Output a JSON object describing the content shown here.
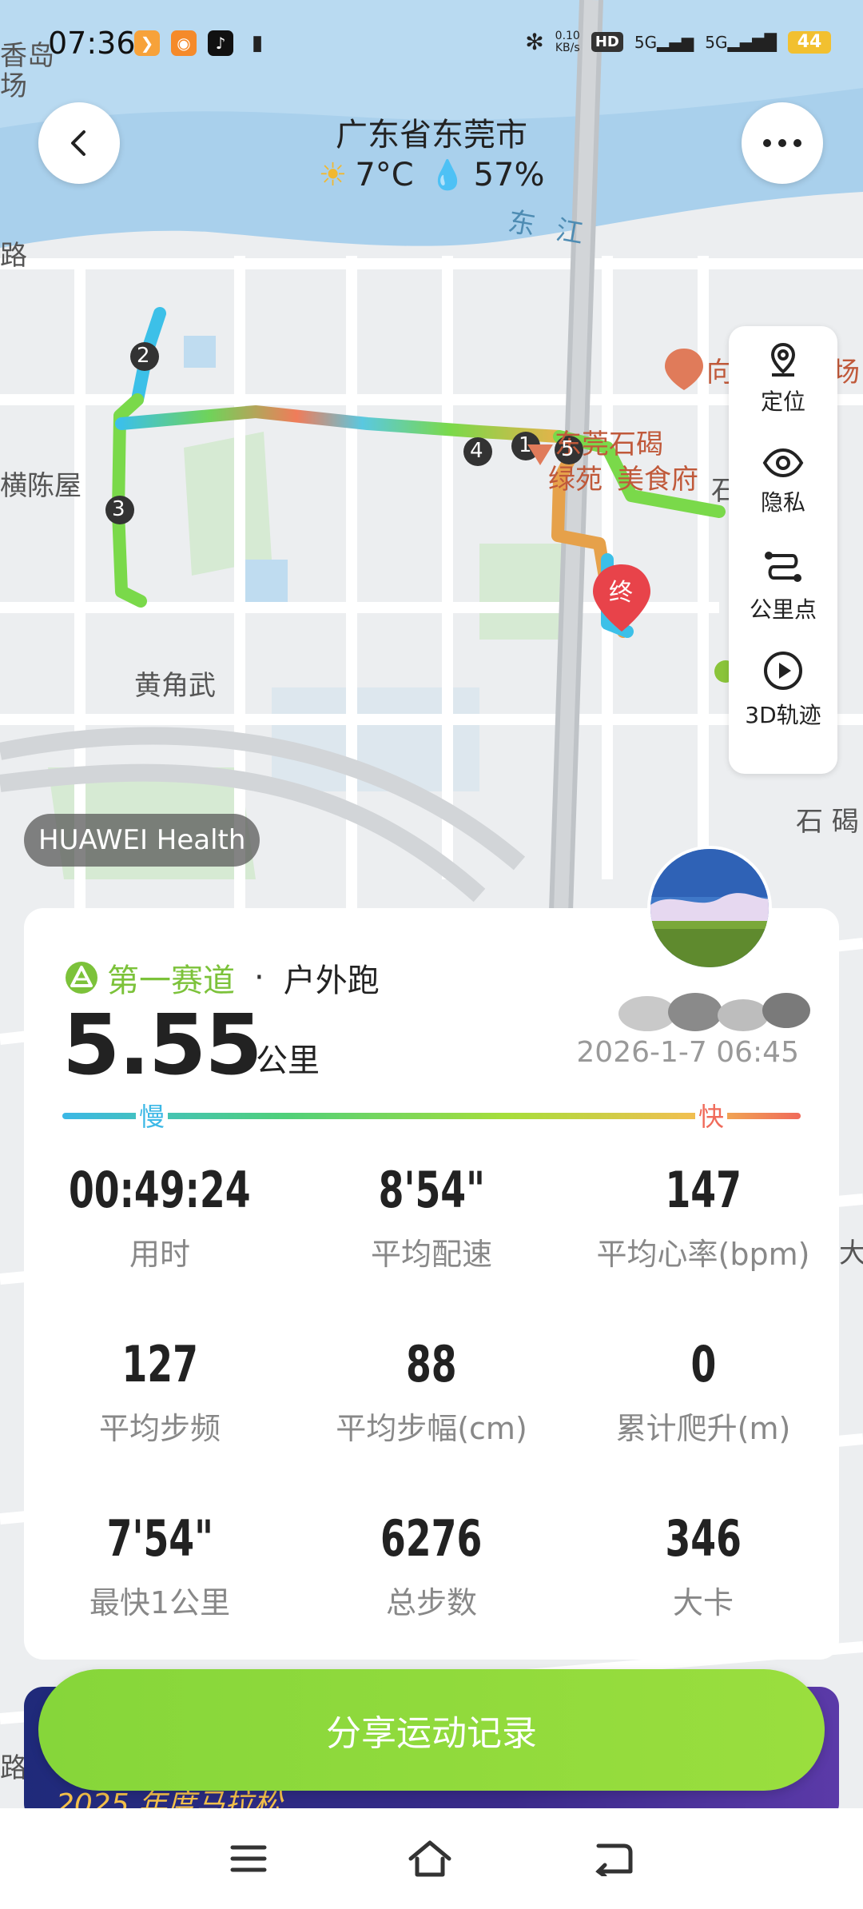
{
  "status_bar": {
    "time": "07:36",
    "net_speed_value": "0.10",
    "net_speed_unit": "KB/s",
    "hd_label": "HD",
    "signal_1": "5G",
    "signal_2": "5G",
    "battery": "44"
  },
  "header": {
    "location": "广东省东莞市",
    "temperature": "7°C",
    "humidity": "57%"
  },
  "map": {
    "labels": {
      "top_left": "香岛",
      "top_left_2": "场",
      "road": "路",
      "river": "东 江",
      "village": "陈屋",
      "village_prefix": "横",
      "poi_huangjiaowu": "黄角武",
      "poi_shijie": "东莞石碣",
      "poi_food": "美食府",
      "poi_food_prefix": "绿苑",
      "right_cut": "向",
      "right_cut_2": "场",
      "shi": "石",
      "shijie_right": "石 碣",
      "left_edge_road": "路",
      "right_edge": "大"
    },
    "markers": [
      "1",
      "2",
      "3",
      "4",
      "5"
    ],
    "end_marker": "终"
  },
  "toolbar": {
    "items": [
      {
        "label": "定位",
        "icon": "location-pin-icon"
      },
      {
        "label": "隐私",
        "icon": "eye-icon"
      },
      {
        "label": "公里点",
        "icon": "route-points-icon"
      },
      {
        "label": "3D轨迹",
        "icon": "play-circle-icon"
      }
    ]
  },
  "badge": "HUAWEI Health",
  "card": {
    "route_name": "第一赛道",
    "separator": "·",
    "activity_type": "户外跑",
    "distance": "5.55",
    "distance_unit": "公里",
    "date": "2026-1-7 06:45",
    "pace_slow": "慢",
    "pace_fast": "快",
    "stats": [
      {
        "value": "00:49:24",
        "label": "用时"
      },
      {
        "value": "8'54\"",
        "label": "平均配速"
      },
      {
        "value": "147",
        "label": "平均心率(bpm)"
      },
      {
        "value": "127",
        "label": "平均步频"
      },
      {
        "value": "88",
        "label": "平均步幅(cm)"
      },
      {
        "value": "0",
        "label": "累计爬升(m)"
      },
      {
        "value": "7'54\"",
        "label": "最快1公里"
      },
      {
        "value": "6276",
        "label": "总步数"
      },
      {
        "value": "346",
        "label": "大卡"
      }
    ]
  },
  "share_button": "分享运动记录",
  "promo_text": "2025 年度马拉松",
  "colors": {
    "accent_green": "#86d63a",
    "pace_slow": "#3cb8e6",
    "pace_fast": "#f06a5a",
    "route_green": "#7cc23a"
  }
}
